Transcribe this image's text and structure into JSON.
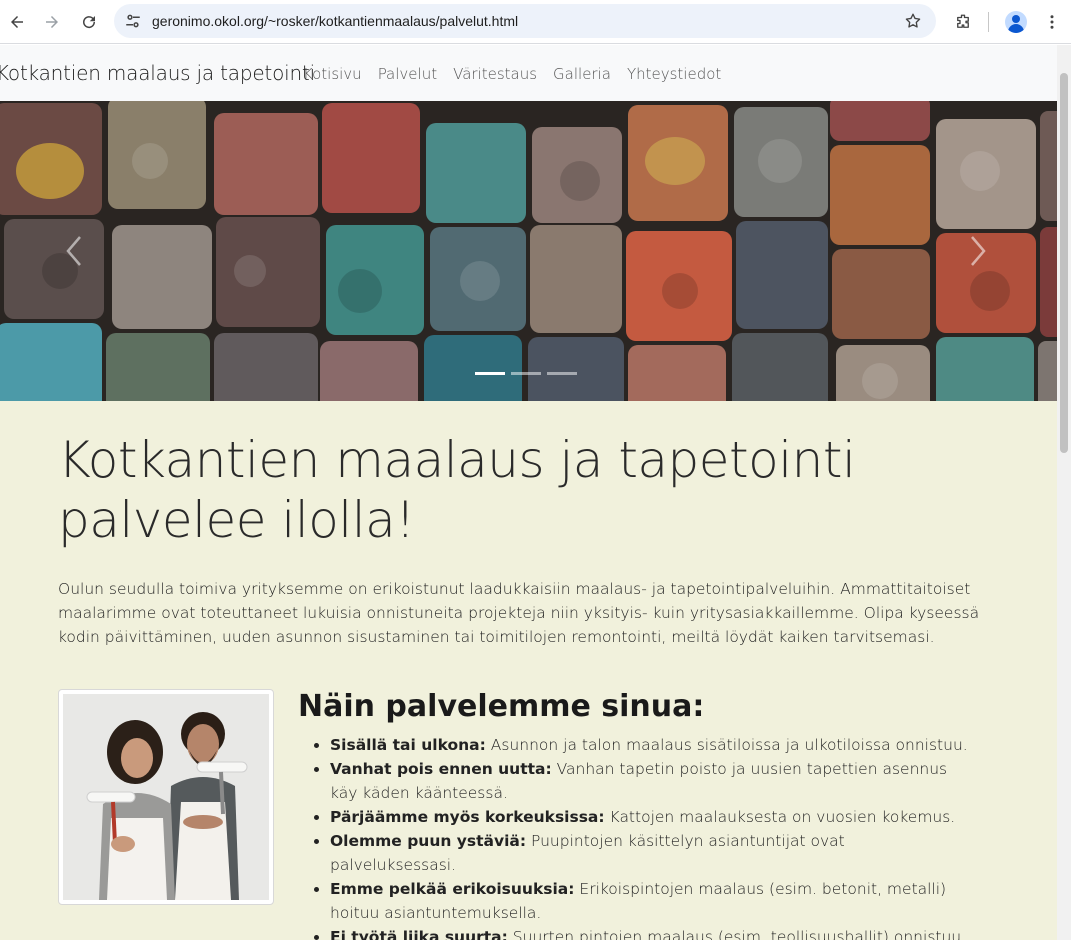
{
  "browser": {
    "url": "geronimo.okol.org/~rosker/kotkantienmaalaus/palvelut.html",
    "icons": [
      "back-icon",
      "forward-icon",
      "reload-icon",
      "site-info-icon",
      "bookmark-star-icon",
      "extensions-icon",
      "profile-avatar",
      "more-menu-icon"
    ]
  },
  "navbar": {
    "brand": "Kotkantien maalaus ja tapetointi",
    "links": [
      {
        "label": "Kotisivu"
      },
      {
        "label": "Palvelut"
      },
      {
        "label": "Väritestaus"
      },
      {
        "label": "Galleria"
      },
      {
        "label": "Yhteystiedot"
      }
    ]
  },
  "carousel": {
    "slide_count": 3,
    "active_slide": 1,
    "prev_icon": "chevron-left-icon",
    "next_icon": "chevron-right-icon"
  },
  "main": {
    "title": "Kotkantien maalaus ja tapetointi palvelee ilolla!",
    "intro": "Oulun seudulla toimiva yrityksemme on erikoistunut laadukkaisiin maalaus- ja tapetointipalveluihin. Ammattitaitoiset maalarimme ovat toteuttaneet lukuisia onnistuneita projekteja niin yksityis- kuin yritysasiakkaillemme. Olipa kyseessä kodin päivittäminen, uuden asunnon sisustaminen tai toimitilojen remontointi, meiltä löydät kaiken tarvitsemasi."
  },
  "services": {
    "title": "Näin palvelemme sinua:",
    "items": [
      {
        "bold": "Sisällä tai ulkona:",
        "text": "Asunnon ja talon maalaus sisätiloissa ja ulkotiloissa onnistuu."
      },
      {
        "bold": "Vanhat pois ennen uutta:",
        "text": "Vanhan tapetin poisto ja uusien tapettien asennus käy käden käänteessä."
      },
      {
        "bold": "Pärjäämme myös korkeuksissa:",
        "text": "Kattojen maalauksesta on vuosien kokemus."
      },
      {
        "bold": "Olemme puun ystäviä:",
        "text": "Puupintojen käsittelyn asiantuntijat ovat palveluksessasi."
      },
      {
        "bold": "Emme pelkää erikoisuuksia:",
        "text": "Erikoispintojen maalaus (esim. betonit, metalli) hoituu asiantuntemuksella."
      },
      {
        "bold": "Ei työtä liika suurta:",
        "text": "Suurten pintojen maalaus (esim. teollisuushallit) onnistuu."
      }
    ]
  },
  "colors": {
    "page_background": "#f1f1dc",
    "navbar_background": "#f8f9fa",
    "omnibox_background": "#edf2fa"
  }
}
